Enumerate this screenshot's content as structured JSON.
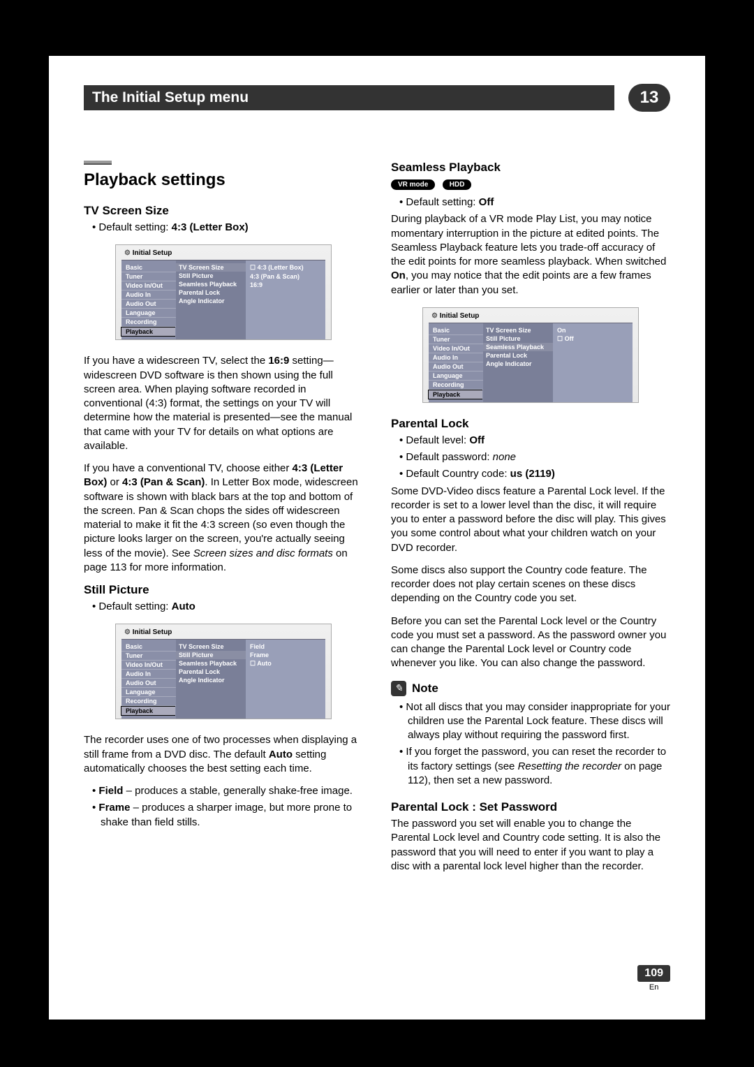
{
  "header": {
    "title": "The Initial Setup menu",
    "chapter": "13"
  },
  "footer": {
    "page": "109",
    "lang": "En"
  },
  "labels": {
    "note": "Note"
  },
  "badges": {
    "vrmode": "VR mode",
    "hdd": "HDD"
  },
  "menu": {
    "title": "Initial Setup",
    "left": [
      "Basic",
      "Tuner",
      "Video In/Out",
      "Audio In",
      "Audio Out",
      "Language",
      "Recording",
      "Playback"
    ],
    "mid": [
      "TV Screen Size",
      "Still Picture",
      "Seamless Playback",
      "Parental Lock",
      "Angle Indicator"
    ]
  },
  "menus": {
    "tvscreen": {
      "options": [
        "☐ 4:3 (Letter Box)",
        "4:3 (Pan & Scan)",
        "16:9"
      ]
    },
    "still": {
      "options": [
        "Field",
        "Frame",
        "☐ Auto"
      ]
    },
    "seamless": {
      "options": [
        "On",
        "☐ Off"
      ]
    }
  },
  "left": {
    "h2": "Playback settings",
    "tvscreen": {
      "h3": "TV Screen Size",
      "default_pre": "Default setting: ",
      "default_val": "4:3 (Letter Box)",
      "p1a": "If you have a widescreen TV, select the ",
      "p1b": "16:9",
      "p1c": " setting—widescreen DVD software is then shown using the full screen area. When playing software recorded in conventional (4:3) format, the settings on your TV will determine how the material is presented—see the manual that came with your TV for details on what options are available.",
      "p2a": "If you have a conventional TV, choose either ",
      "p2b": "4:3 (Letter Box)",
      "p2c": " or ",
      "p2d": "4:3 (Pan & Scan)",
      "p2e": ". In Letter Box mode, widescreen software is shown with black bars at the top and bottom of the screen. Pan & Scan chops the sides off widescreen material to make it fit the 4:3 screen (so even though the picture looks larger on the screen, you're actually seeing less of the movie). See ",
      "p2f": "Screen sizes and disc formats",
      "p2g": " on page 113 for more information."
    },
    "still": {
      "h3": "Still Picture",
      "default_pre": "Default setting: ",
      "default_val": "Auto",
      "p1a": "The recorder uses one of two processes when displaying a still frame from a DVD disc. The default ",
      "p1b": "Auto",
      "p1c": " setting automatically chooses the best setting each time.",
      "b1a": "Field",
      "b1b": " – produces a stable, generally shake-free image.",
      "b2a": "Frame",
      "b2b": " – produces a sharper image, but more prone to shake than field stills."
    }
  },
  "right": {
    "seamless": {
      "h3": "Seamless Playback",
      "default_pre": "Default setting: ",
      "default_val": "Off",
      "p1a": "During playback of a VR mode Play List, you may notice momentary interruption in the picture at edited points. The Seamless Playback feature lets you trade-off accuracy of the edit points for more seamless playback. When switched ",
      "p1b": "On",
      "p1c": ", you may notice that the edit points are a few frames earlier or later than you set."
    },
    "parental": {
      "h3": "Parental Lock",
      "b1_pre": "Default level: ",
      "b1_val": "Off",
      "b2_pre": "Default password: ",
      "b2_val": "none",
      "b3_pre": "Default Country code: ",
      "b3_val": "us (2119)",
      "p1": "Some DVD-Video discs feature a Parental Lock level. If the recorder is set to a lower level than the disc, it will require you to enter a password before the disc will play. This gives you some control about what your children watch on your DVD recorder.",
      "p2": "Some discs also support the Country code feature. The recorder does not play certain scenes on these discs depending on the Country code you set.",
      "p3": "Before you can set the Parental Lock level or the Country code you must set a password. As the password owner you can change the Parental Lock level or Country code whenever you like. You can also change the password.",
      "n1": "Not all discs that you may consider inappropriate for your children use the Parental Lock feature. These discs will always play without requiring the password first.",
      "n2a": "If you forget the password, you can reset the recorder to its factory settings (see ",
      "n2b": "Resetting the recorder",
      "n2c": " on page 112), then set a new password."
    },
    "setpw": {
      "h3": "Parental Lock : Set Password",
      "p1": "The password you set will enable you to change the Parental Lock level and Country code setting. It is also the password that you will need to enter if you want to play a disc with a parental lock level higher than the recorder."
    }
  }
}
